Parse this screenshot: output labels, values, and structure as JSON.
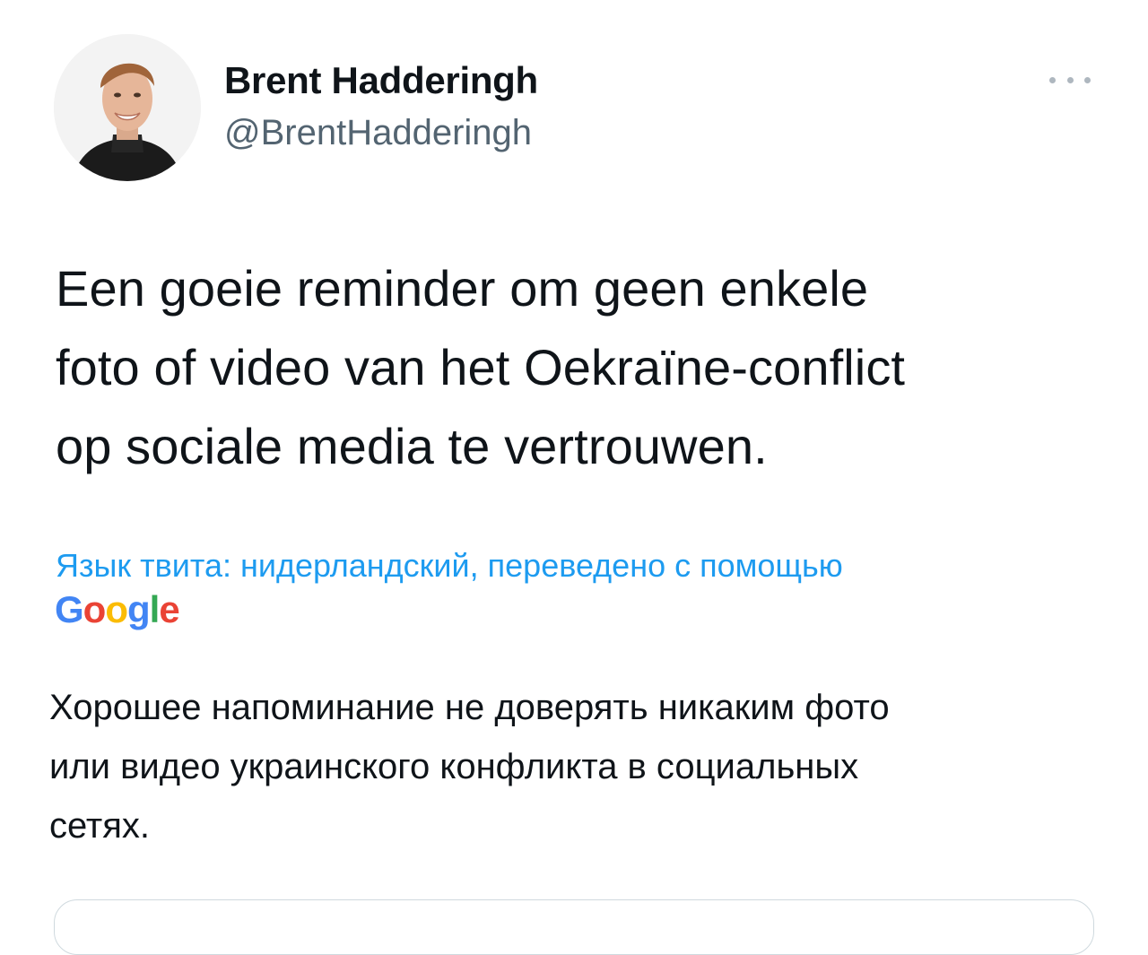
{
  "author": {
    "name": "Brent Hadderingh",
    "handle": "@BrentHadderingh"
  },
  "tweet": {
    "text_lines": [
      "Een goeie reminder om geen enkele",
      "foto of video van het Oekraïne-conflict",
      "op sociale media te vertrouwen."
    ]
  },
  "translation": {
    "label": "Язык твита: нидерландский, переведено с помощью",
    "provider": [
      "G",
      "o",
      "o",
      "g",
      "l",
      "e"
    ],
    "text_lines": [
      "Хорошее напоминание не доверять никаким фото",
      "или видео украинского конфликта в социальных",
      "сетях."
    ]
  },
  "icons": {
    "more": "more-horizontal-icon",
    "avatar": "user-avatar"
  },
  "colors": {
    "link": "#1d9bf0",
    "secondary": "#536471",
    "google_blue": "#4285f4",
    "google_red": "#ea4335",
    "google_yellow": "#fbbc05",
    "google_green": "#34a853"
  }
}
